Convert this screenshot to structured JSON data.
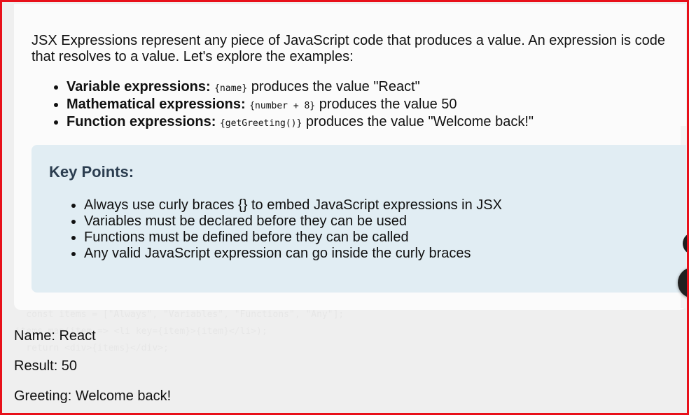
{
  "intro": {
    "text": "JSX Expressions represent any piece of JavaScript code that produces a value. An expression is code that resolves to a value. Let's explore the examples:"
  },
  "expressions": [
    {
      "label": "Variable expressions:",
      "code": "{name}",
      "desc": "produces the value \"React\""
    },
    {
      "label": "Mathematical expressions:",
      "code": "{number + 8}",
      "desc": "produces the value 50"
    },
    {
      "label": "Function expressions:",
      "code": "{getGreeting()}",
      "desc": "produces the value \"Welcome back!\""
    }
  ],
  "key_points": {
    "title": "Key Points:",
    "items": [
      "Always use curly braces {} to embed JavaScript expressions in JSX",
      "Variables must be declared before they can be used",
      "Functions must be defined before they can be called",
      "Any valid JavaScript expression can go inside the curly braces"
    ]
  },
  "output": {
    "name": "Name: React",
    "result": "Result: 50",
    "greeting": "Greeting: Welcome back!"
  },
  "colors": {
    "frame": "#e8101a",
    "keypoints_bg": "#e1edf3",
    "keypoints_title": "#2c3e50"
  }
}
